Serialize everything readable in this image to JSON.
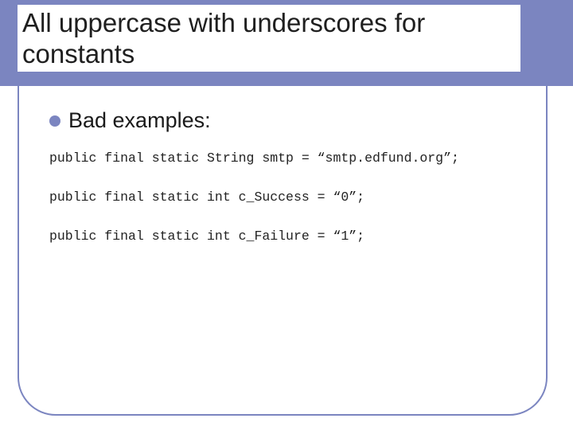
{
  "title": "All uppercase with underscores for constants",
  "bullet": {
    "label": "Bad examples:"
  },
  "code": {
    "line1": "public final static String smtp = “smtp.edfund.org”;",
    "line2": "public final static int c_Success = “0”;",
    "line3": "public final static int c_Failure = “1”;"
  }
}
